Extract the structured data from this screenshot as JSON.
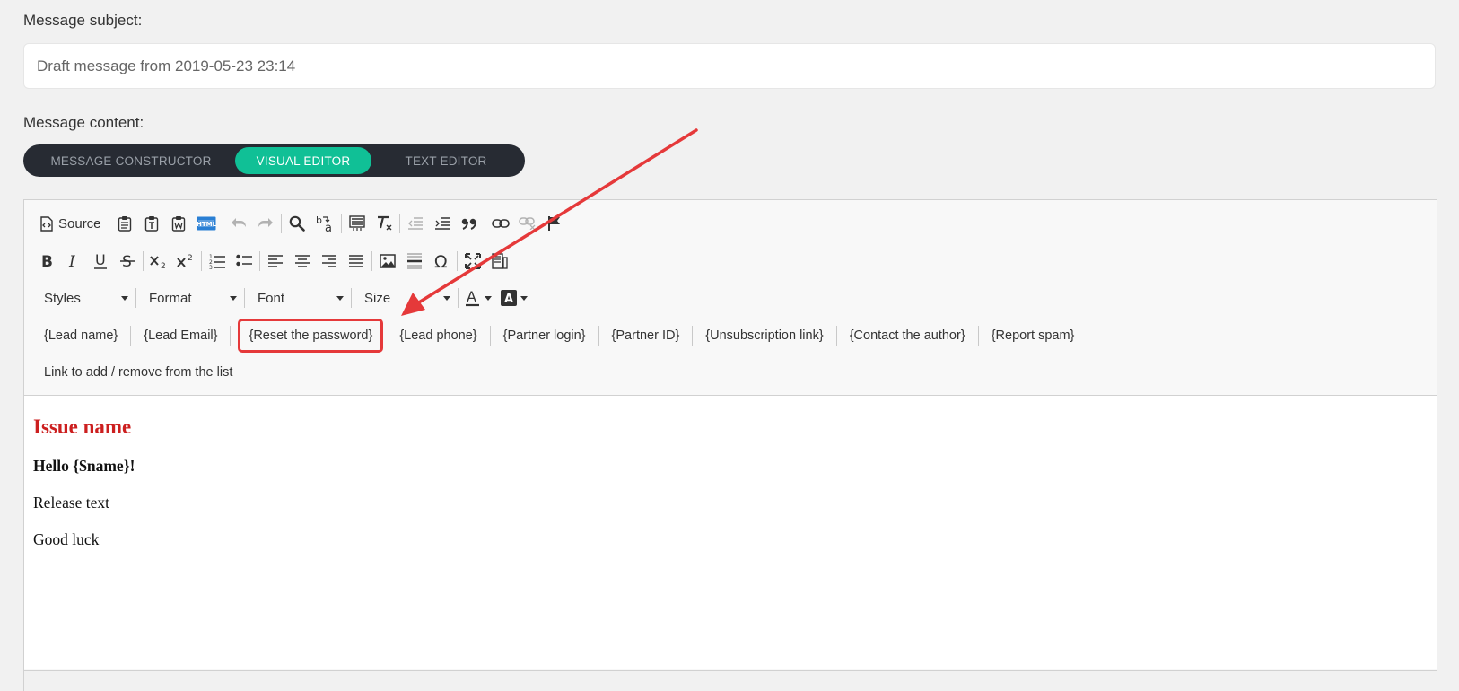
{
  "subject": {
    "label": "Message subject:",
    "value": "Draft message from 2019-05-23 23:14"
  },
  "content_section": {
    "label": "Message content:"
  },
  "tabs": [
    {
      "label": "MESSAGE CONSTRUCTOR",
      "active": false
    },
    {
      "label": "VISUAL EDITOR",
      "active": true
    },
    {
      "label": "TEXT EDITOR",
      "active": false
    }
  ],
  "toolbar": {
    "source_label": "Source",
    "combos": {
      "styles": "Styles",
      "format": "Format",
      "font": "Font",
      "size": "Size"
    },
    "placeholders": [
      "{Lead name}",
      "{Lead Email}",
      "{Reset the password}",
      "{Lead phone}",
      "{Partner login}",
      "{Partner ID}",
      "{Unsubscription link}",
      "{Contact the author}",
      "{Report spam}"
    ],
    "list_link": "Link to add / remove from the list"
  },
  "body": {
    "heading": "Issue name",
    "greeting": "Hello {$name}!",
    "line1": "Release text",
    "line2": "Good luck"
  },
  "colors": {
    "accent": "#10c096",
    "tabs_bg": "#272b33",
    "highlight": "#e5393a",
    "heading": "#cc1f1f"
  }
}
